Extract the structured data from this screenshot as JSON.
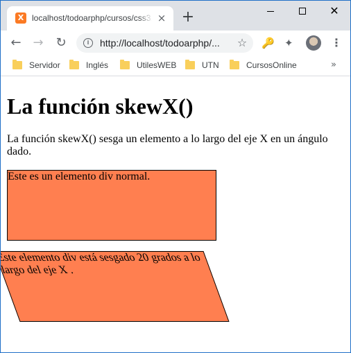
{
  "browser": {
    "tab_title": "localhost/todoarphp/cursos/css3/...",
    "tab_favicon": "X",
    "new_tab_icon": "+",
    "close_tab_icon": "×",
    "url": "http://localhost/todoarphp/...",
    "window_controls": {
      "close_glyph": "✕"
    },
    "icons": {
      "back": "←",
      "forward": "→",
      "reload": "↻",
      "star": "☆",
      "key": "🔑",
      "extensions": "✦",
      "menu": "⋮",
      "more_bookmarks": "»"
    }
  },
  "bookmarks": [
    {
      "label": "Servidor"
    },
    {
      "label": "Inglés"
    },
    {
      "label": "UtilesWEB"
    },
    {
      "label": "UTN"
    },
    {
      "label": "CursosOnline"
    }
  ],
  "page": {
    "heading": "La función skewX()",
    "description": "La función skewX() sesga un elemento a lo largo del eje X en un ángulo dado.",
    "normal_box_text": "Este es un elemento div normal.",
    "skewed_box_text": "Este elemento div está sesgado 20 grados a lo largo del eje X .",
    "box_color": "#ff7f50",
    "skew_degrees": 20
  }
}
